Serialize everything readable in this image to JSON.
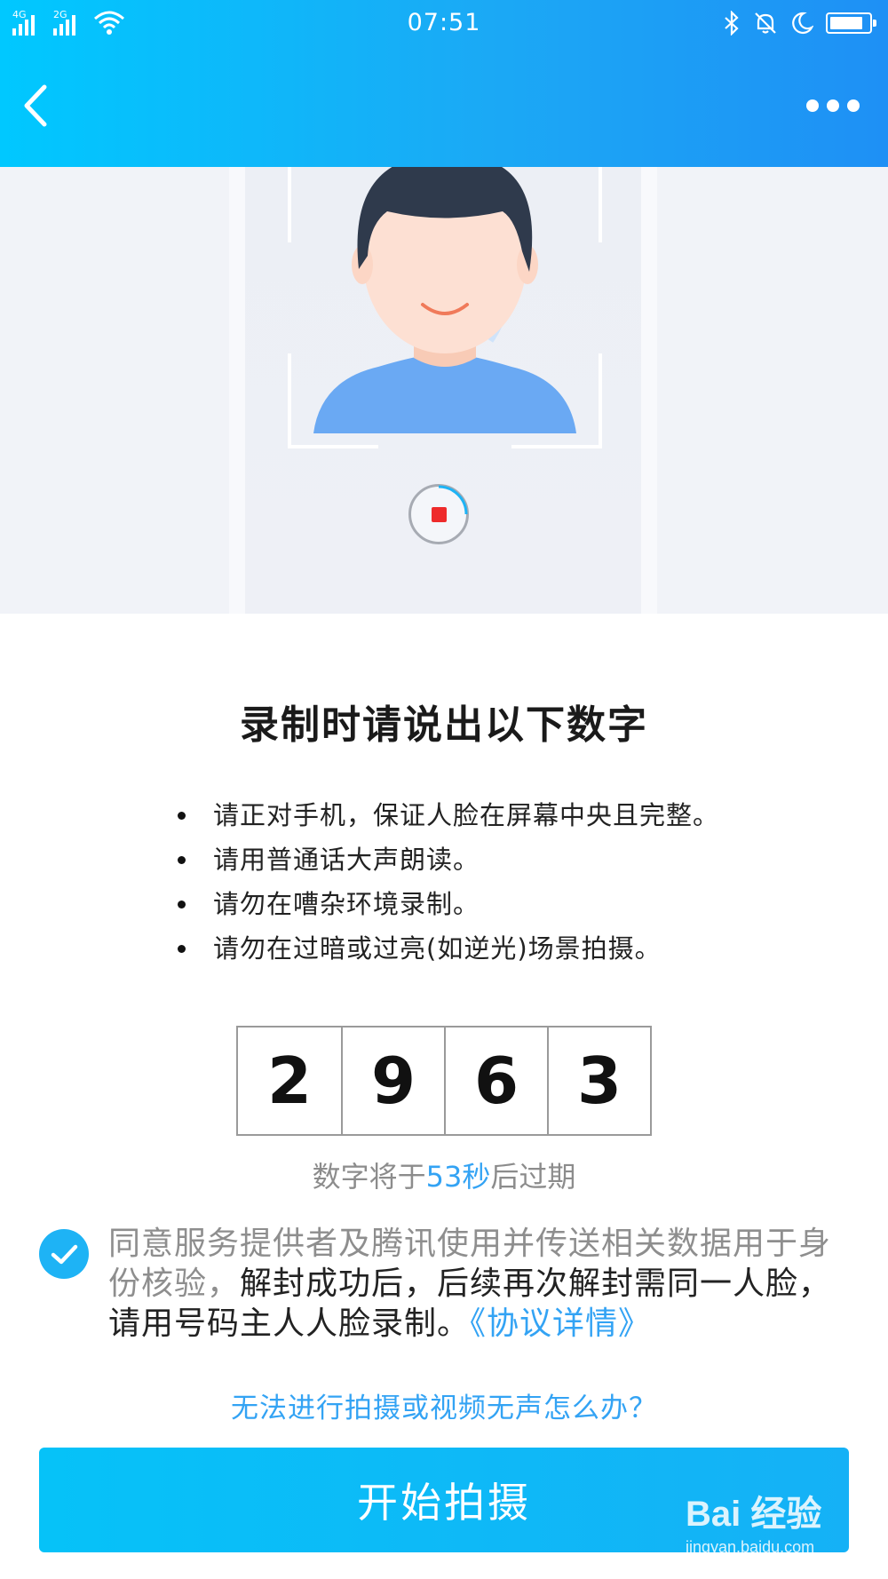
{
  "status_bar": {
    "time": "07:51",
    "signal1_label": "4G",
    "signal2_label": "2G",
    "icons": [
      "signal-icon",
      "wifi-icon",
      "bluetooth-icon",
      "mute-bell-icon",
      "moon-icon",
      "battery-icon"
    ]
  },
  "nav": {
    "back_icon": "chevron-left-icon",
    "more_icon": "more-dots-icon"
  },
  "preview": {
    "record_button": "stop-record-icon"
  },
  "title": "录制时请说出以下数字",
  "tips": [
    "请正对手机，保证人脸在屏幕中央且完整。",
    "请用普通话大声朗读。",
    "请勿在嘈杂环境录制。",
    "请勿在过暗或过亮(如逆光)场景拍摄。"
  ],
  "code_digits": [
    "2",
    "9",
    "6",
    "3"
  ],
  "expire": {
    "prefix": "数字将于",
    "seconds": "53秒",
    "suffix": "后过期"
  },
  "agreement": {
    "checked": true,
    "muted_text": "同意服务提供者及腾讯使用并传送相关数据用于身份核验，",
    "text": "解封成功后，后续再次解封需同一人脸，请用号码主人人脸录制。",
    "link": "《协议详情》"
  },
  "help_link": "无法进行拍摄或视频无声怎么办？",
  "start_button": "开始拍摄",
  "watermark": {
    "brand": "Bai 经验",
    "sub": "jingyan.baidu.com"
  },
  "colors": {
    "accent": "#1eb3f5",
    "link": "#33a3f4",
    "record": "#ee2b2b"
  }
}
